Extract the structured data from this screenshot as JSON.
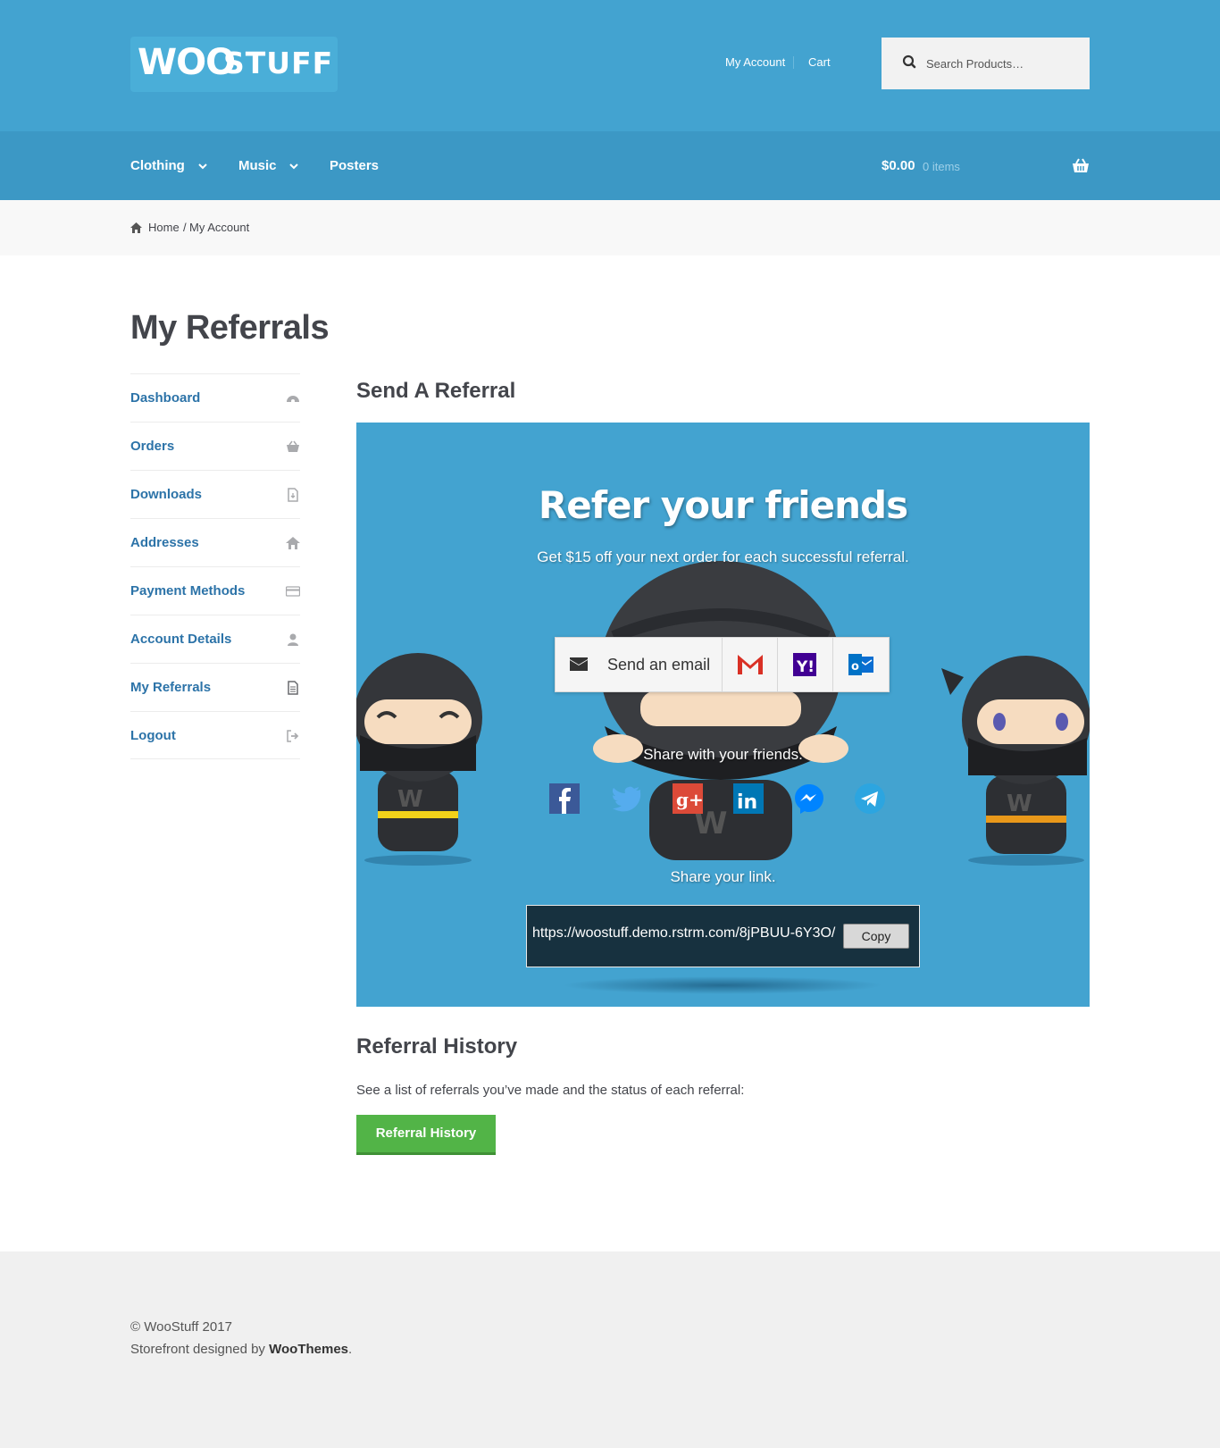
{
  "brand": {
    "logo_word1": "WOO",
    "logo_word2": "STUFF",
    "primary_color": "#43a3d0",
    "nav_color": "#3c98c5",
    "button_color": "#52b447"
  },
  "header": {
    "secondary_nav": [
      "My Account",
      "Cart"
    ],
    "search_placeholder": "Search Products…"
  },
  "primary_nav": {
    "items": [
      "Clothing",
      "Music",
      "Posters"
    ],
    "cart_total": "$0.00",
    "cart_count": "0 items"
  },
  "breadcrumb": {
    "home": "Home",
    "separator": "/",
    "current": "My Account"
  },
  "page_title": "My Referrals",
  "account_nav": [
    {
      "label": "Dashboard",
      "icon": "dashboard-icon"
    },
    {
      "label": "Orders",
      "icon": "basket-icon"
    },
    {
      "label": "Downloads",
      "icon": "file-download-icon"
    },
    {
      "label": "Addresses",
      "icon": "home-icon"
    },
    {
      "label": "Payment Methods",
      "icon": "credit-card-icon"
    },
    {
      "label": "Account Details",
      "icon": "user-icon"
    },
    {
      "label": "My Referrals",
      "icon": "document-icon"
    },
    {
      "label": "Logout",
      "icon": "sign-out-icon"
    }
  ],
  "send_referral": {
    "heading": "Send A Referral",
    "widget_title": "Refer your friends",
    "widget_subtitle": "Get $15 off your next order for each successful referral.",
    "email_label": "Send an email",
    "email_providers": [
      "gmail-icon",
      "yahoo-icon",
      "outlook-icon"
    ],
    "share_text": "Share with your friends.",
    "social": [
      "facebook-icon",
      "twitter-icon",
      "google-plus-icon",
      "linkedin-icon",
      "messenger-icon",
      "telegram-icon"
    ],
    "link_text_label": "Share your link.",
    "link_value": "https://woostuff.demo.rstrm.com/8jPBUU-6Y3O/",
    "copy_label": "Copy"
  },
  "referral_history": {
    "heading": "Referral History",
    "description": "See a list of referrals you’ve made and the status of each referral:",
    "button_label": "Referral History"
  },
  "footer": {
    "copyright": "© WooStuff 2017",
    "designed_by_prefix": "Storefront designed by ",
    "designed_by_name": "WooThemes",
    "designed_by_suffix": "."
  }
}
